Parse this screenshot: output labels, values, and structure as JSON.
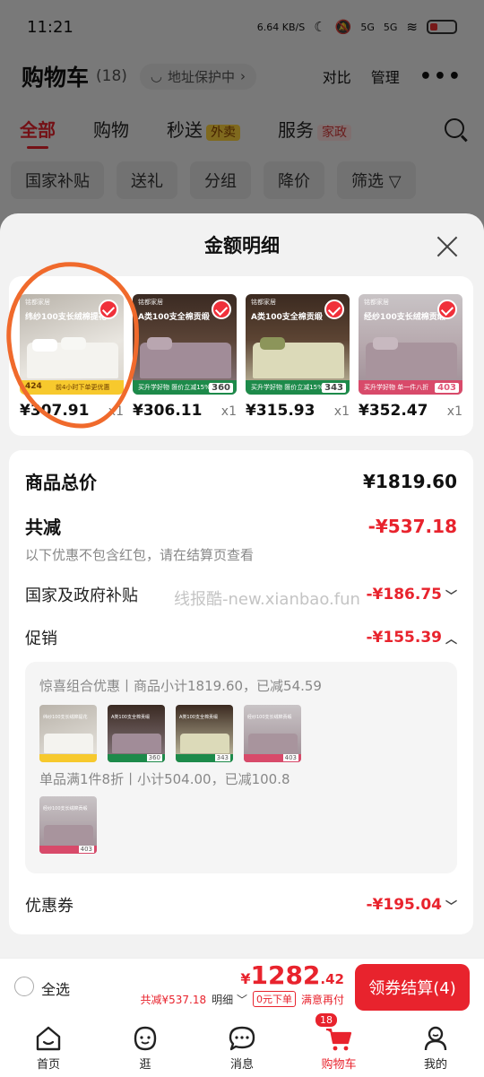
{
  "status_bar": {
    "time": "11:21",
    "speed": "6.64 KB/S",
    "signal": "5G",
    "signal2": "5G"
  },
  "header": {
    "title": "购物车",
    "count": "(18)",
    "address": "地址保护中",
    "compare": "对比",
    "manage": "管理"
  },
  "tabs": [
    {
      "label": "全部"
    },
    {
      "label": "购物"
    },
    {
      "label": "秒送",
      "badge": "外卖"
    },
    {
      "label": "服务",
      "badge": "家政"
    }
  ],
  "chips": [
    "国家补贴",
    "送礼",
    "分组",
    "降价",
    "筛选"
  ],
  "sheet": {
    "title": "金额明细",
    "products": [
      {
        "title": "纬纱100支长绒棉提花",
        "price": "¥307.91",
        "qty": "x1",
        "tag": "424",
        "strip_text": "前4小时下单更优惠"
      },
      {
        "title": "A类100支全棉贡缎",
        "price": "¥306.11",
        "qty": "x1",
        "tag": "360",
        "strip_text": "买升学好物 匯价立减15%"
      },
      {
        "title": "A类100支全棉贡缎",
        "price": "¥315.93",
        "qty": "x1",
        "tag": "343",
        "strip_text": "买升学好物 匯价立减15%"
      },
      {
        "title": "经纱100支长绒棉贡缎",
        "price": "¥352.47",
        "qty": "x1",
        "tag": "403",
        "strip_text": "买升学好物 单一件八折"
      }
    ],
    "summary": {
      "goods_total_label": "商品总价",
      "goods_total_value": "¥1819.60",
      "total_discount_label": "共减",
      "total_discount_value": "-¥537.18",
      "note": "以下优惠不包含红包，请在结算页查看",
      "subsidy_label": "国家及政府补贴",
      "subsidy_value": "-¥186.75",
      "watermark": "线报酷-new.xianbao.fun",
      "promo_label": "促销",
      "promo_value": "-¥155.39",
      "promo_group1": "惊喜组合优惠丨商品小计1819.60，已减54.59",
      "promo_group2": "单品满1件8折丨小计504.00，已减100.8",
      "coupon_label": "优惠券",
      "coupon_value": "-¥195.04"
    }
  },
  "checkout": {
    "select_all": "全选",
    "total_yen": "¥",
    "total_int": "1282",
    "total_dec": ".42",
    "discount_line": "共减¥537.18",
    "detail": "明细",
    "zero_order": "0元下单",
    "satisfied": "满意再付",
    "pay_button": "领券结算(4)"
  },
  "bottom_nav": [
    {
      "label": "首页"
    },
    {
      "label": "逛"
    },
    {
      "label": "消息"
    },
    {
      "label": "购物车",
      "badge": "18"
    },
    {
      "label": "我的"
    }
  ],
  "colors": {
    "accent": "#e8232d",
    "highlight_ring": "#f06a2c"
  }
}
